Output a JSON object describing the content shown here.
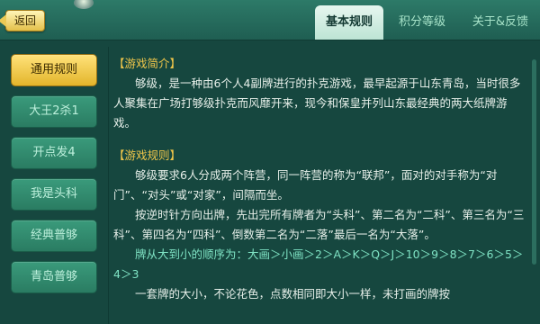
{
  "header": {
    "back_label": "返回",
    "tabs": [
      "基本规则",
      "积分等级",
      "关于&反馈"
    ],
    "active_tab": 0
  },
  "sidebar": {
    "items": [
      "通用规则",
      "大王2杀1",
      "开点发4",
      "我是头科",
      "经典普够",
      "青岛普够"
    ],
    "active": 0
  },
  "content": {
    "intro_title": "【游戏简介】",
    "intro_text": "够级，是一种由6个人4副牌进行的扑克游戏，最早起源于山东青岛，当时很多人聚集在广场打够级扑克而风靡开来，现今和保皇并列山东最经典的两大纸牌游戏。",
    "rules_title": "【游戏规则】",
    "rules_p1": "够级要求6人分成两个阵营，同一阵营的称为“联邦”，面对的对手称为“对门”、“对头”或“对家”，间隔而坐。",
    "rules_p2": "按逆时针方向出牌，先出完所有牌者为“头科”、第二名为“二科”、第三名为“三科”、第四名为“四科”、倒数第二名为“二落”最后一名为“大落”。",
    "rules_p3": "牌从大到小的顺序为：大画＞小画＞2＞A＞K＞Q＞J＞10＞9＞8＞7＞6＞5＞4＞3",
    "rules_p4": "一套牌的大小，不论花色，点数相同即大小一样，未打画的牌按"
  },
  "colors": {
    "background": "#16473f",
    "accent_gold": "#f0c64a",
    "highlight_text": "#7fe3c4"
  }
}
